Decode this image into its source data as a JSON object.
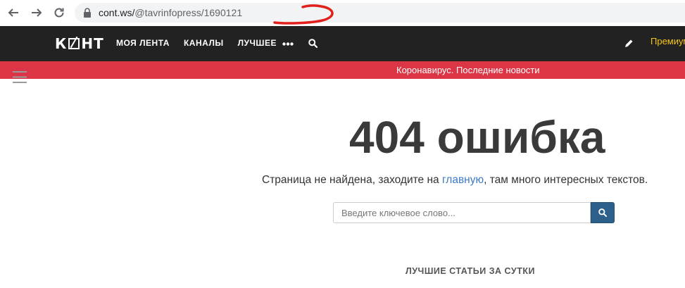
{
  "browser": {
    "url_host": "cont.ws/",
    "url_path": "@tavrinfopress/1690121"
  },
  "header": {
    "logo_text": [
      "К",
      "НТ"
    ],
    "menu": [
      "МОЯ ЛЕНТА",
      "КАНАЛЫ",
      "ЛУЧШЕЕ"
    ],
    "premium_label": "Премиум"
  },
  "banner": {
    "text": "Коронавирус. Последние новости"
  },
  "main": {
    "title": "404 ошибка",
    "subtitle_before": "Страница не найдена, заходите на ",
    "subtitle_link": "главную",
    "subtitle_after": ", там много интересных текстов.",
    "search_placeholder": "Введите ключевое слово...",
    "best_heading": "ЛУЧШИЕ СТАТЬИ ЗА СУТКИ"
  },
  "colors": {
    "header_bg": "#222222",
    "banner_bg": "#dc3545",
    "premium": "#f5c518",
    "link": "#3b7cc4",
    "search_button": "#2d5f8b"
  }
}
